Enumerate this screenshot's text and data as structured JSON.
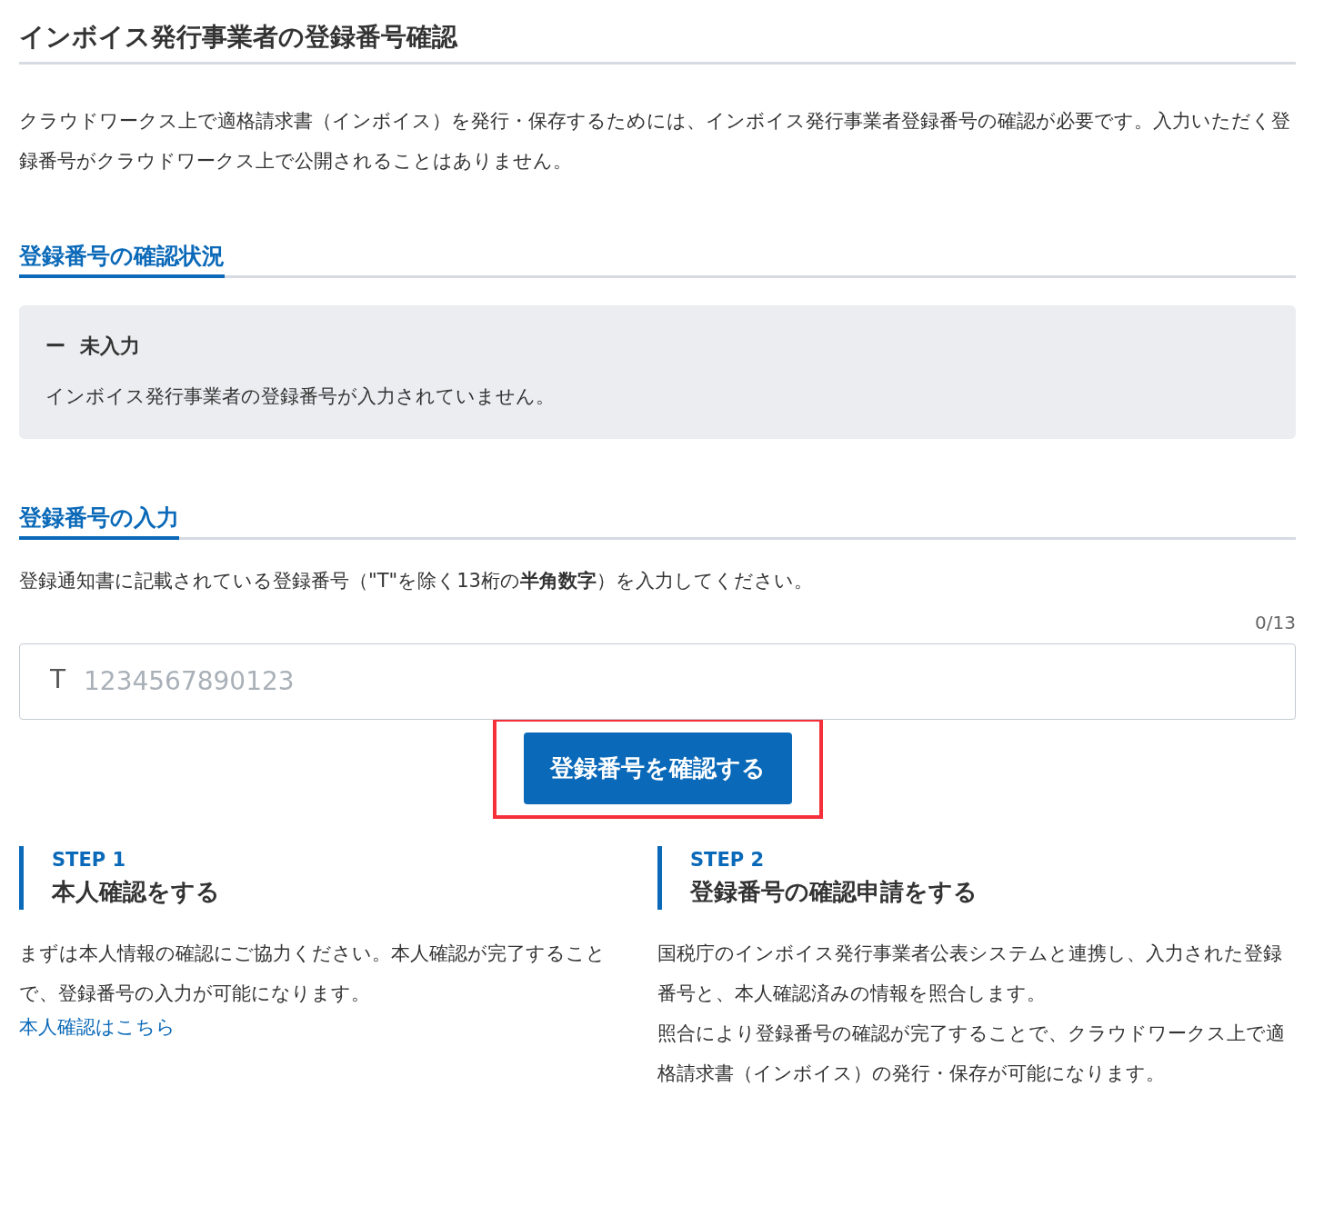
{
  "page": {
    "title": "インボイス発行事業者の登録番号確認"
  },
  "intro": "クラウドワークス上で適格請求書（インボイス）を発行・保存するためには、インボイス発行事業者登録番号の確認が必要です。入力いただく登録番号がクラウドワークス上で公開されることはありません。",
  "status_section": {
    "heading": "登録番号の確認状況",
    "status_mark": "ー",
    "status_label": "未入力",
    "message": "インボイス発行事業者の登録番号が入力されていません。"
  },
  "input_section": {
    "heading": "登録番号の入力",
    "instruction": "登録通知書に記載されている登録番号（\"T\"を除く13桁の**半角数字**）を入力してください。",
    "counter": "0/13",
    "prefix": "T",
    "placeholder": "1234567890123",
    "button": {
      "label": "登録番号を確認する",
      "highlighted": true
    }
  },
  "steps": [
    {
      "step": "STEP 1",
      "title": "本人確認をする",
      "paragraphs": [
        "まずは本人情報の確認にご協力ください。本人確認が完了することで、登録番号の入力が可能になります。"
      ],
      "link": "本人確認はこちら"
    },
    {
      "step": "STEP 2",
      "title": "登録番号の確認申請をする",
      "paragraphs": [
        "国税庁のインボイス発行事業者公表システムと連携し、入力された登録番号と、本人確認済みの情報を照合します。",
        "照合により登録番号の確認が完了することで、クラウドワークス上で適格請求書（インボイス）の発行・保存が可能になります。"
      ]
    }
  ]
}
